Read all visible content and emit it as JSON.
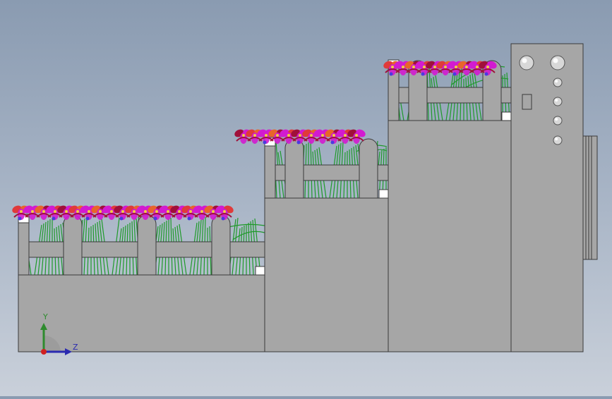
{
  "scene": {
    "description_free": true,
    "colors": {
      "background_top": "#8a9bb1",
      "background_bottom": "#c9d0da",
      "body_fill": "#a6a6a6",
      "body_stroke": "#3a3a3a",
      "leaf": "#1f9a2a",
      "petal_magenta": "#d21bd0",
      "petal_red": "#e03a3a",
      "petal_orange": "#e8652a",
      "petal_dark": "#a0103a",
      "petal_blue": "#4a3adf",
      "knob": "#d8d8d8"
    },
    "icons": [
      "triad-axis-icon",
      "knob-icon",
      "flower-icon"
    ]
  },
  "triad": {
    "y_label": "Y",
    "z_label": "Z",
    "y_color": "#2e8b2e",
    "z_color": "#2a2ab0",
    "x_color": "#d02020"
  }
}
